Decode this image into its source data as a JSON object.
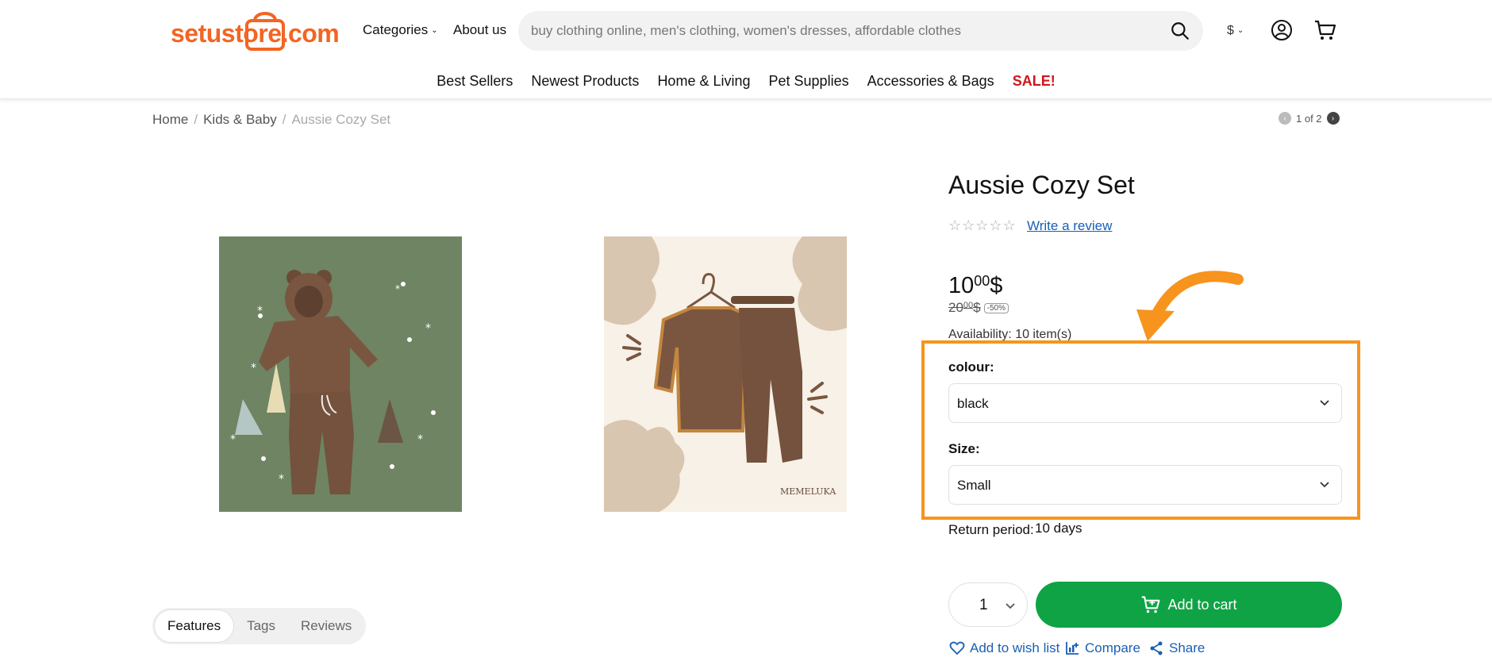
{
  "header": {
    "logo_text": "setustore.com",
    "categories_label": "Categories",
    "about_label": "About us",
    "search_placeholder": "buy clothing online, men's clothing, women's dresses, affordable clothes",
    "currency_label": "$",
    "nav": [
      "Best Sellers",
      "Newest Products",
      "Home & Living",
      "Pet Supplies",
      "Accessories & Bags",
      "SALE!"
    ]
  },
  "breadcrumb": {
    "items": [
      "Home",
      "Kids & Baby",
      "Aussie Cozy Set"
    ],
    "separator": "/"
  },
  "pager": {
    "text": "1 of 2"
  },
  "gallery": {
    "image2_watermark": "MEMELUKA"
  },
  "product": {
    "title": "Aussie Cozy Set",
    "stars": "☆☆☆☆☆",
    "write_review": "Write a review",
    "price_main": "10",
    "price_cents": "00",
    "price_currency": "$",
    "old_price_main": "20",
    "old_price_cents": "00",
    "old_price_currency": "$",
    "discount": "-50%",
    "availability": "Availability: 10 item(s)",
    "colour_label": "colour:",
    "colour_value": "black",
    "size_label": "Size:",
    "size_value": "Small",
    "return_label": "Return period:",
    "return_value": "10 days",
    "quantity": "1",
    "add_to_cart": "Add to cart",
    "wishlist": "Add to wish list",
    "compare": "Compare",
    "share": "Share"
  },
  "tabs": [
    "Features",
    "Tags",
    "Reviews"
  ],
  "colors": {
    "brand": "#f26522",
    "highlight": "#f7941d",
    "cart_button": "#0fa345",
    "sale": "#d0161c",
    "link": "#1a5fb4"
  }
}
